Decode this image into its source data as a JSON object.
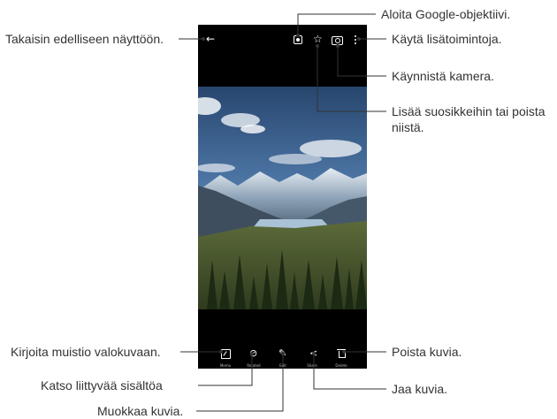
{
  "toolbar": {
    "memo": "Memo",
    "related": "Related",
    "edit": "Edit",
    "share": "Share",
    "delete": "Delete"
  },
  "callouts": {
    "back": "Takaisin edelliseen näyttöön.",
    "lens": "Aloita Google-objektiivi.",
    "more": "Käytä lisätoimintoja.",
    "camera": "Käynnistä kamera.",
    "favorite_line1": "Lisää suosikkeihin tai poista",
    "favorite_line2": "niistä.",
    "memo": "Kirjoita muistio valokuvaan.",
    "related": "Katso liittyvää sisältöa",
    "edit": "Muokkaa kuvia.",
    "delete": "Poista kuvia.",
    "share": "Jaa kuvia."
  },
  "icons": {
    "back": "back-arrow-icon",
    "lens": "google-lens-icon",
    "favorite": "star-icon",
    "camera": "camera-icon",
    "more": "more-vertical-icon",
    "memo": "memo-icon",
    "related": "related-icon",
    "edit": "pencil-icon",
    "share": "share-icon",
    "delete": "trash-icon"
  },
  "colors": {
    "callout_line": "#333333",
    "screen_bg": "#000000"
  }
}
